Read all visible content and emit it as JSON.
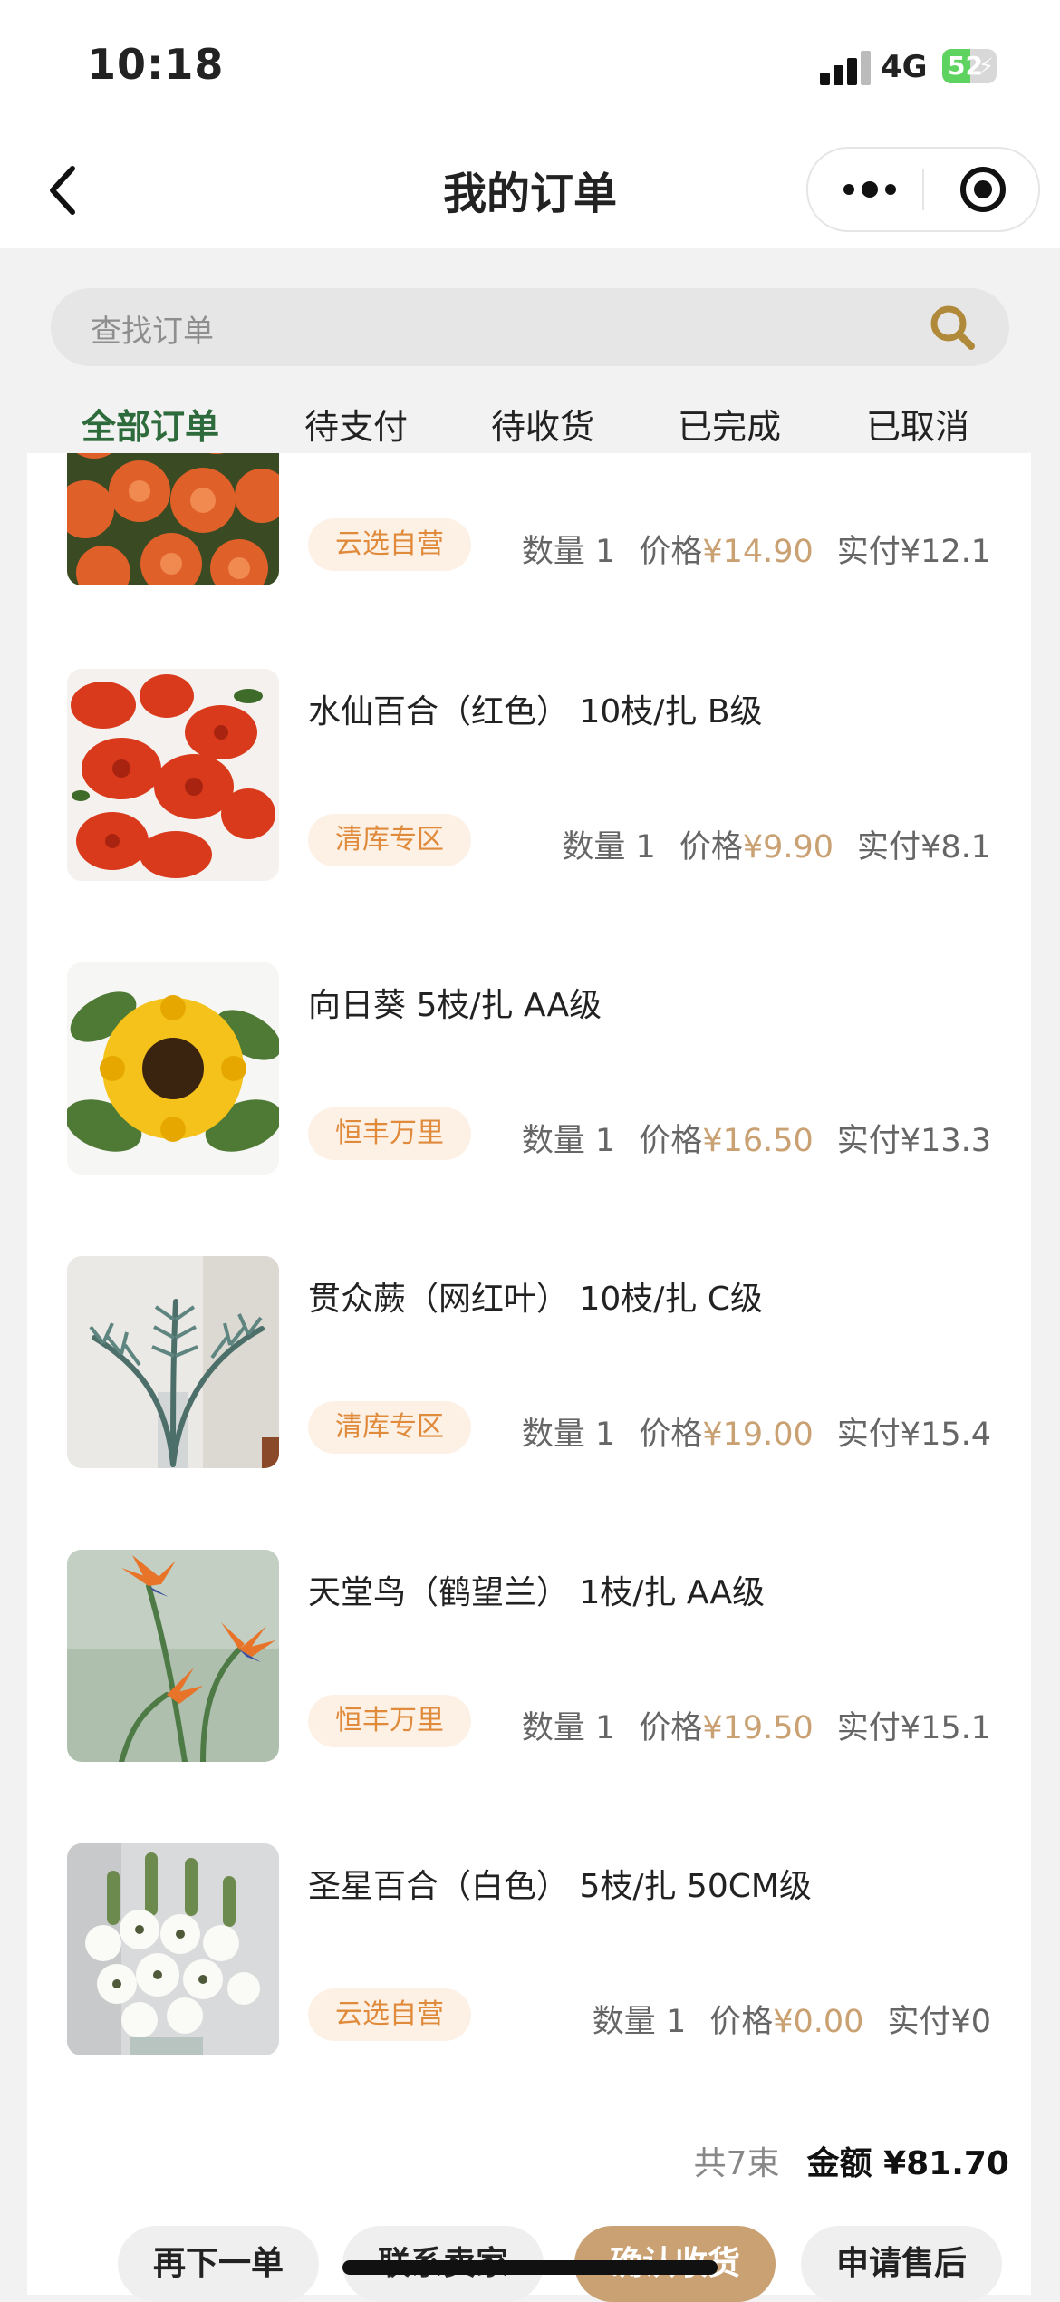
{
  "status_bar": {
    "time": "10:18",
    "network": "4G",
    "battery": "52",
    "battery_level": 0.52
  },
  "nav": {
    "title": "我的订单",
    "back_icon": "chevron-left-icon",
    "more_icon": "more-dots-icon",
    "close_icon": "target-circle-icon"
  },
  "search": {
    "placeholder": "查找订单",
    "icon": "search-icon"
  },
  "tabs": [
    {
      "label": "全部订单",
      "active": true
    },
    {
      "label": "待支付",
      "active": false
    },
    {
      "label": "待收货",
      "active": false
    },
    {
      "label": "已完成",
      "active": false
    },
    {
      "label": "已取消",
      "active": false
    }
  ],
  "labels": {
    "qty": "数量",
    "price": "价格",
    "paid": "实付"
  },
  "items": [
    {
      "name": "",
      "tag": "云选自营",
      "qty": "1",
      "price": "¥14.90",
      "paid": "¥12.1",
      "image": "orange-roses"
    },
    {
      "name": "水仙百合（红色） 10枝/扎  B级",
      "tag": "清库专区",
      "qty": "1",
      "price": "¥9.90",
      "paid": "¥8.1",
      "image": "red-alstroemeria"
    },
    {
      "name": "向日葵 5枝/扎  AA级",
      "tag": "恒丰万里",
      "qty": "1",
      "price": "¥16.50",
      "paid": "¥13.3",
      "image": "sunflower"
    },
    {
      "name": "贯众蕨（网红叶） 10枝/扎  C级",
      "tag": "清库专区",
      "qty": "1",
      "price": "¥19.00",
      "paid": "¥15.4",
      "image": "fern-leaves"
    },
    {
      "name": "天堂鸟（鹤望兰） 1枝/扎  AA级",
      "tag": "恒丰万里",
      "qty": "1",
      "price": "¥19.50",
      "paid": "¥15.1",
      "image": "bird-of-paradise"
    },
    {
      "name": "圣星百合（白色） 5枝/扎  50CM级",
      "tag": "云选自营",
      "qty": "1",
      "price": "¥0.00",
      "paid": "¥0",
      "image": "white-star-lily"
    }
  ],
  "summary": {
    "count": "共7束",
    "amount": "金额 ¥81.70"
  },
  "actions": {
    "reorder": "再下一单",
    "contact": "联系卖家",
    "confirm": "确认收货",
    "after_sales": "申请售后"
  },
  "colors": {
    "accent": "#c9a173",
    "tab_active": "#2e6b3c",
    "tag_bg": "#fdf1e6",
    "tag_text": "#e08a3c"
  }
}
